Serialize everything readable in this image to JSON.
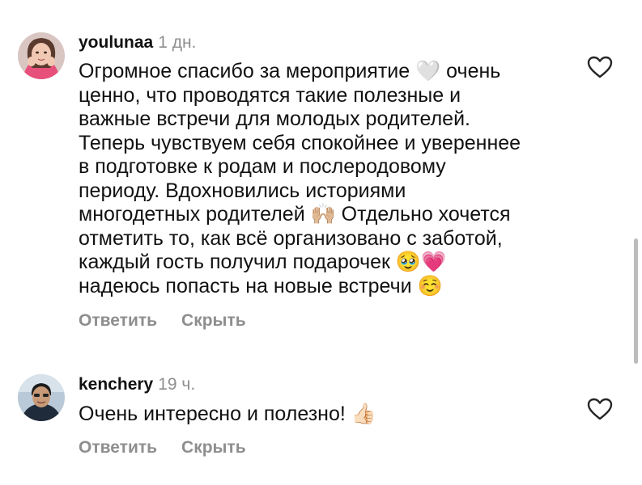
{
  "comments": [
    {
      "username": "youlunaa",
      "time": "1 дн.",
      "lines": [
        "Огромное спасибо за мероприятие 🤍 очень",
        "ценно, что проводятся такие полезные и",
        "важные встречи для молодых родителей.",
        "Теперь чувствуем себя спокойнее и увереннее",
        "в подготовке к родам и послеродовому",
        "периоду. Вдохновились историями",
        "многодетных родителей 🙌🏼 Отдельно хочется",
        "отметить то, как всё организовано с заботой,",
        "каждый гость получил подарочек 🥹💗",
        "надеюсь попасть на новые встречи ☺️"
      ],
      "reply_label": "Ответить",
      "hide_label": "Скрыть",
      "like_icon": "heart-outline-icon"
    },
    {
      "username": "kenchery",
      "time": "19 ч.",
      "lines": [
        "Очень интересно и полезно! 👍🏻"
      ],
      "reply_label": "Ответить",
      "hide_label": "Скрыть",
      "like_icon": "heart-outline-icon"
    }
  ],
  "colors": {
    "text": "#111111",
    "secondary": "#8e8e8e",
    "scrollbar": "#bdbdbd"
  }
}
